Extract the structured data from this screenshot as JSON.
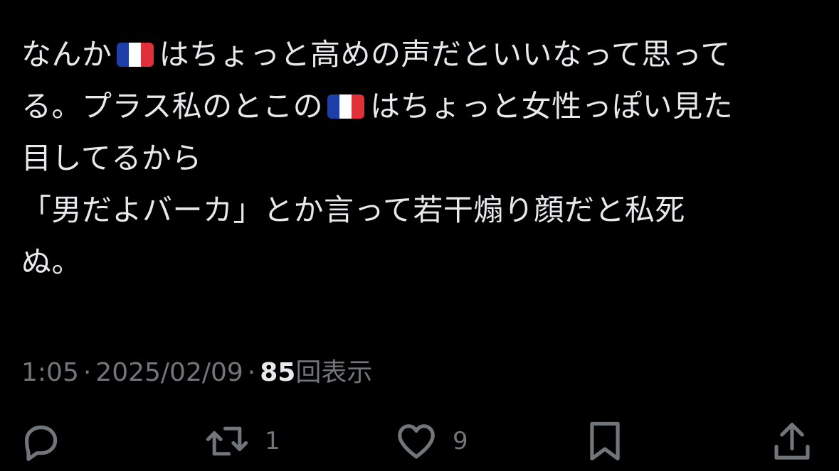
{
  "tweet": {
    "line1_a": "なんか",
    "line1_b": "はちょっと高めの声だといいなって思って",
    "line2_a": "る。プラス私のとこの",
    "line2_b": "はちょっと女性っぽい見た",
    "line3": "目してるから",
    "line4": "「男だよバーカ」とか言って若干煽り顔だと私死",
    "line5": "ぬ。",
    "flag_emoji": "flag-france",
    "flag_colors": [
      "#1f3fa8",
      "#ffffff",
      "#e0303a"
    ]
  },
  "meta": {
    "time": "1:05",
    "separator": "·",
    "date": "2025/02/09",
    "views_count": "85",
    "views_label": "回表示"
  },
  "actions": {
    "reply_icon": "reply-icon",
    "retweet_icon": "retweet-icon",
    "retweet_count": "1",
    "like_icon": "heart-icon",
    "like_count": "9",
    "bookmark_icon": "bookmark-icon",
    "share_icon": "share-icon"
  },
  "colors": {
    "background": "#000000",
    "text": "#e7e9ea",
    "secondary": "#71767b"
  }
}
